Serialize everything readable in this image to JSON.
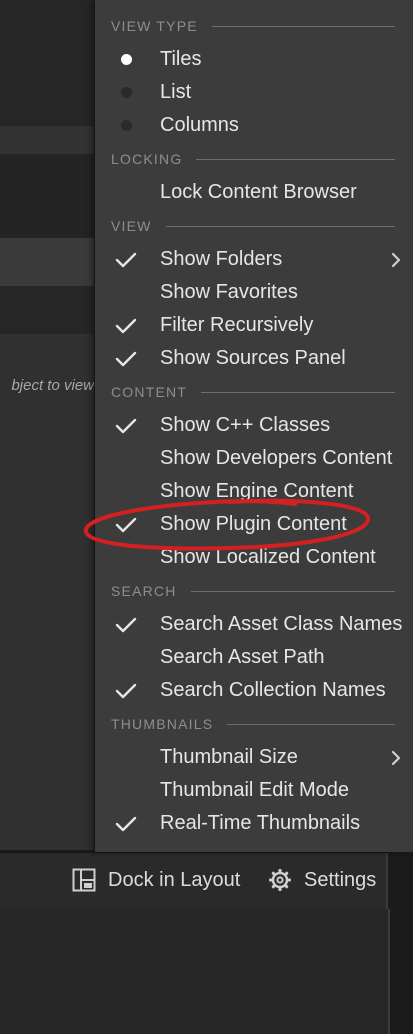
{
  "background": {
    "hint_text": "bject to view"
  },
  "bottom_bar": {
    "dock_label": "Dock in Layout",
    "settings_label": "Settings"
  },
  "menu": {
    "sections": {
      "view_type": "VIEW TYPE",
      "locking": "LOCKING",
      "view": "VIEW",
      "content": "CONTENT",
      "search": "SEARCH",
      "thumbnails": "THUMBNAILS"
    },
    "view_type": {
      "tiles": {
        "label": "Tiles",
        "selected": true
      },
      "list": {
        "label": "List",
        "selected": false
      },
      "columns": {
        "label": "Columns",
        "selected": false
      }
    },
    "locking": {
      "lock": {
        "label": "Lock Content Browser",
        "checked": false
      }
    },
    "view": {
      "show_folders": {
        "label": "Show Folders",
        "checked": true,
        "submenu": true
      },
      "show_favorites": {
        "label": "Show Favorites",
        "checked": false
      },
      "filter_recursively": {
        "label": "Filter Recursively",
        "checked": true
      },
      "show_sources": {
        "label": "Show Sources Panel",
        "checked": true
      }
    },
    "content": {
      "cpp_classes": {
        "label": "Show C++ Classes",
        "checked": true
      },
      "developers": {
        "label": "Show Developers Content",
        "checked": false
      },
      "engine": {
        "label": "Show Engine Content",
        "checked": false
      },
      "plugin": {
        "label": "Show Plugin Content",
        "checked": true
      },
      "localized": {
        "label": "Show Localized Content",
        "checked": false
      }
    },
    "search": {
      "asset_class": {
        "label": "Search Asset Class Names",
        "checked": true
      },
      "asset_path": {
        "label": "Search Asset Path",
        "checked": false
      },
      "collection": {
        "label": "Search Collection Names",
        "checked": true
      }
    },
    "thumbnails": {
      "size": {
        "label": "Thumbnail Size",
        "checked": false,
        "submenu": true
      },
      "edit_mode": {
        "label": "Thumbnail Edit Mode",
        "checked": false
      },
      "realtime": {
        "label": "Real-Time Thumbnails",
        "checked": true
      }
    }
  },
  "colors": {
    "menu_bg": "#3c3c3c",
    "text": "#e6e6e6",
    "section_text": "#8e8e8e",
    "annotation": "#d42020"
  },
  "icons": {
    "check": "check-icon",
    "radio_on": "radio-selected-icon",
    "radio_off": "radio-unselected-icon",
    "submenu": "chevron-right-icon",
    "dock": "dock-layout-icon",
    "settings": "gear-icon"
  }
}
